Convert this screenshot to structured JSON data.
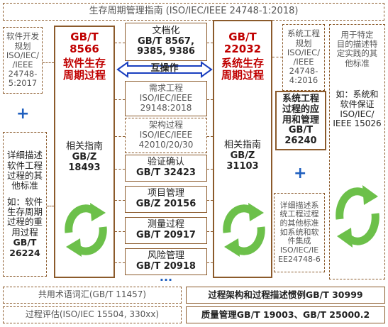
{
  "top": {
    "title": "生存周期管理指南 (ISO/IEC/IEEE 24748-1:2018)"
  },
  "left_top": {
    "lines": [
      "软件开发",
      "规划",
      "ISO/IEC/",
      "/IEEE",
      "24748-",
      "5:2017"
    ]
  },
  "left_bottom": {
    "lines_a": [
      "详细描述",
      "软件工程",
      "过程的其",
      "他标准"
    ],
    "lines_b": [
      "如：软件",
      "生存周期",
      "过程的重",
      "用过程"
    ],
    "code_a": "GB/T",
    "code_b": "26224"
  },
  "sw_column": {
    "std_a": "GB/T",
    "std_b": "8566",
    "name_a": "软件生存",
    "name_b": "周期过程",
    "guide_label": "相关指南",
    "guide_code_a": "GB/Z",
    "guide_code_b": "18493"
  },
  "sys_column": {
    "std_a": "GB/T",
    "std_b": "22032",
    "name_a": "系统生存",
    "name_b": "周期过程",
    "guide_label": "相关指南",
    "guide_code_a": "GB/Z",
    "guide_code_b": "31103"
  },
  "middle": {
    "doc": {
      "label": "文档化",
      "code_a": "GB/T 8567,",
      "code_b": "9385, 9386"
    },
    "interop": {
      "label": "互操作"
    },
    "req": {
      "label": "需求工程",
      "code_a": "ISO/IEC/IEEE",
      "code_b": "29148:2018"
    },
    "arch": {
      "label": "架构过程",
      "code_a": "ISO/IEC/IEEE",
      "code_b": "42010/20/30"
    },
    "vv": {
      "label": "验证确认",
      "code": "GB/T 32423"
    },
    "pm": {
      "label": "项目管理",
      "code": "GB/Z 20156"
    },
    "meas": {
      "label": "测量过程",
      "code": "GB/T 20917"
    },
    "risk": {
      "label": "风险管理",
      "code": "GB/T 20918"
    },
    "more": "..."
  },
  "right_sys_plan": {
    "lines": [
      "系统工程",
      "规划",
      "ISO/IEC/",
      "/IEEE",
      "24748-",
      "4:2016"
    ]
  },
  "right_apply": {
    "lines": [
      "系统工程",
      "过程的应",
      "用和管理"
    ],
    "code_a": "GB/T",
    "code_b": "26240"
  },
  "right_detail": {
    "lines": [
      "详细描述系",
      "统工程过程",
      "的其他标准",
      "如系统和软",
      "件集成",
      "ISO/IEC/IE",
      "EE24748-6"
    ]
  },
  "far_right": {
    "lines_a": [
      "用于特定",
      "目的描述特",
      "定实践的其",
      "他标准"
    ],
    "lines_b": [
      "如：系统和",
      "软件保证",
      "ISO/IEC/",
      "IEEE 15026"
    ]
  },
  "bottom": {
    "vocab": "共用术语词汇(GB/T 11457)",
    "assess": "过程评估(ISO/IEC 15504, 330xx)",
    "arch_desc": "过程架构和过程描述惯例GB/T 30999",
    "quality": "质量管理GB/T 19003、GB/T 25000.2"
  },
  "colors": {
    "border": "#8b5a2b",
    "accent_red": "#c00000",
    "plus_blue": "#1f5fbf",
    "cycle_green": "#6cc04a",
    "arrow_blue": "#1a3fbf"
  }
}
